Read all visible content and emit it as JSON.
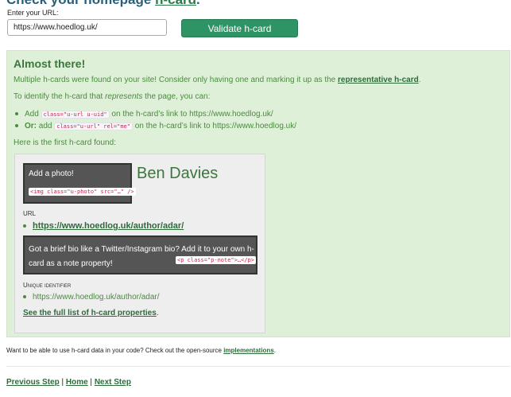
{
  "header": {
    "heading_prefix": "Check your homepage ",
    "heading_link": "h-card",
    "heading_suffix": "."
  },
  "form": {
    "label": "Enter your URL:",
    "url_value": "https://www.hoedlog.uk/",
    "validate_label": "Validate h-card"
  },
  "result": {
    "title": "Almost there!",
    "multiple_text": "Multiple h-cards were found on your site! Consider only having one and marking it up as the ",
    "representative_link": "representative h-card",
    "period": ".",
    "identify_prefix": "To identify the h-card that ",
    "identify_em": "represents",
    "identify_suffix": " the page, you can:",
    "option1_add": "Add",
    "option1_code": "class=\"u-url u-uid\"",
    "option1_text": " on the h-card’s link to https://www.hoedlog.uk/",
    "option2_or": "Or:",
    "option2_add": " add",
    "option2_code": "class=\"u-url\" rel=\"me\"",
    "option2_text": " on the h-card’s link to https://www.hoedlog.uk/",
    "first_found": "Here is the first h-card found:"
  },
  "hcard": {
    "photo_prompt": "Add a photo!",
    "photo_code": "<img class=\"u-photo\" src=\"…\" />",
    "name": "Ben Davies",
    "url_label": "URL",
    "url": "https://www.hoedlog.uk/author/adar/",
    "bio_prompt": "Got a brief bio like a Twitter/Instagram bio? Add it to your own h-card as a note property!",
    "bio_code": "<p class=\"p-note\">…</p>",
    "uid_label": "Unique identifier",
    "uid": "https://www.hoedlog.uk/author/adar/",
    "props_link": "See the full list of h-card properties",
    "props_period": "."
  },
  "footer": {
    "note_prefix": "Want to be able to use h-card data in your code? Check out the open-source ",
    "note_link": "implementations",
    "note_suffix": ".",
    "nav_previous": "Previous Step",
    "nav_home": "Home",
    "nav_next": "Next Step",
    "nav_separator": " | "
  },
  "colors": {
    "button": "#2e9466",
    "panel_bg": "#dff0d8",
    "panel_text": "#4a8b3f",
    "link": "#2d6b3a"
  }
}
